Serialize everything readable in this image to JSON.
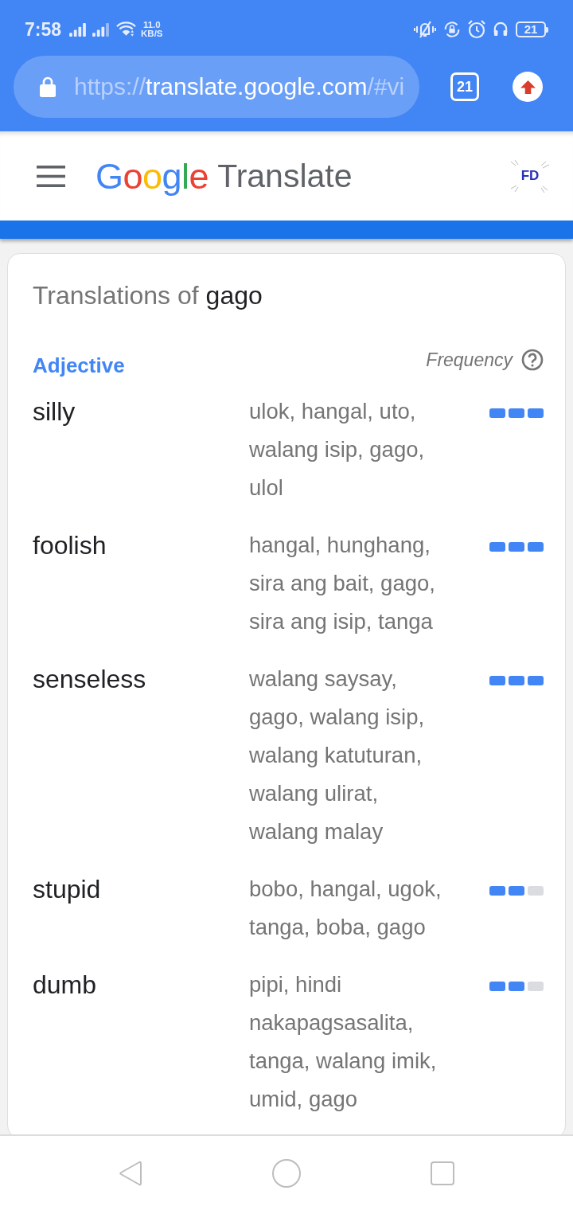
{
  "status_bar": {
    "time": "7:58",
    "network_speed": "11.0",
    "network_speed_unit": "KB/S",
    "battery": "21"
  },
  "browser_toolbar": {
    "url_scheme": "https://",
    "url_host": "translate.google.com",
    "url_path": "/#vi",
    "tab_count": "21"
  },
  "app_header": {
    "brand": "Google",
    "product": "Translate",
    "account_badge": "FD"
  },
  "card": {
    "title": "Translations of",
    "term": "gago",
    "groups": [
      {
        "part_of_speech": "Adjective",
        "frequency_label": "Frequency",
        "rows": [
          {
            "word": "silly",
            "translations": "ulok, hangal, uto, walang isip, gago, ulol",
            "stars": 3
          },
          {
            "word": "foolish",
            "translations": "hangal, hunghang, sira ang bait, gago, sira ang isip, tanga",
            "stars": 3
          },
          {
            "word": "senseless",
            "translations": "walang saysay, gago, walang isip, walang katuturan, walang ulirat, walang malay",
            "stars": 3
          },
          {
            "word": "stupid",
            "translations": "bobo, hangal, ugok, tanga, boba, gago",
            "stars": 2
          },
          {
            "word": "dumb",
            "translations": "pipi, hindi nakapagsasalita, tanga, walang imik, umid, gago",
            "stars": 2
          }
        ]
      }
    ]
  }
}
